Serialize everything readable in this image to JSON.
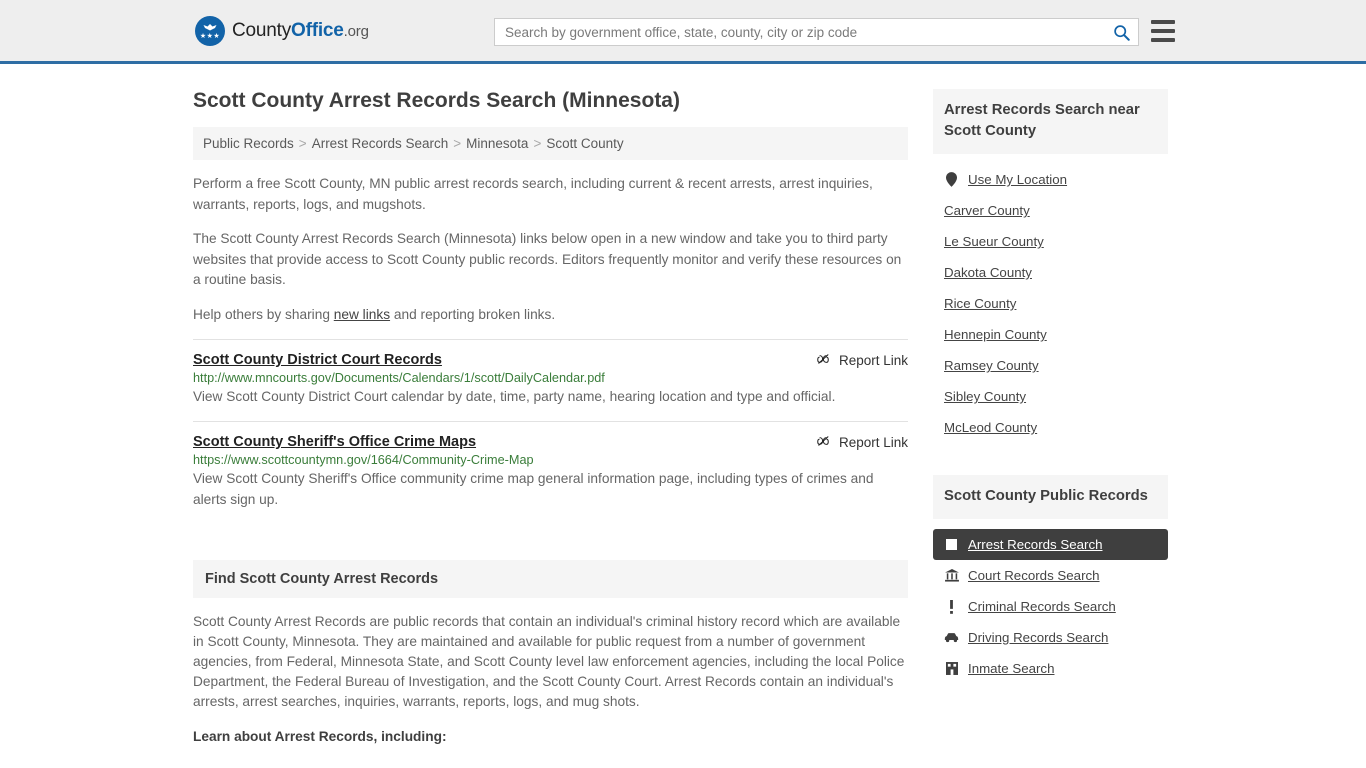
{
  "header": {
    "logo": {
      "part1": "County",
      "part2": "Office",
      "tld": ".org",
      "icon": "eagle-seal-icon"
    },
    "search": {
      "placeholder": "Search by government office, state, county, city or zip code",
      "value": "",
      "search_icon": "search-icon"
    },
    "menu_icon": "hamburger-menu-icon",
    "accent_color": "#2e6da4"
  },
  "page": {
    "title": "Scott County Arrest Records Search (Minnesota)"
  },
  "breadcrumb": {
    "separator": ">",
    "items": [
      {
        "label": "Public Records"
      },
      {
        "label": "Arrest Records Search"
      },
      {
        "label": "Minnesota"
      },
      {
        "label": "Scott County"
      }
    ]
  },
  "intro": {
    "p1": "Perform a free Scott County, MN public arrest records search, including current & recent arrests, arrest inquiries, warrants, reports, logs, and mugshots.",
    "p2": "The Scott County Arrest Records Search (Minnesota) links below open in a new window and take you to third party websites that provide access to Scott County public records. Editors frequently monitor and verify these resources on a routine basis.",
    "p3_before": "Help others by sharing ",
    "p3_link": "new links",
    "p3_after": " and reporting broken links."
  },
  "results": {
    "report_label": "Report Link",
    "report_icon": "broken-link-icon",
    "items": [
      {
        "title": "Scott County District Court Records",
        "url": "http://www.mncourts.gov/Documents/Calendars/1/scott/DailyCalendar.pdf",
        "description": "View Scott County District Court calendar by date, time, party name, hearing location and type and official."
      },
      {
        "title": "Scott County Sheriff's Office Crime Maps",
        "url": "https://www.scottcountymn.gov/1664/Community-Crime-Map",
        "description": "View Scott County Sheriff's Office community crime map general information page, including types of crimes and alerts sign up."
      }
    ]
  },
  "find_section": {
    "heading": "Find Scott County Arrest Records",
    "body": "Scott County Arrest Records are public records that contain an individual's criminal history record which are available in Scott County, Minnesota. They are maintained and available for public request from a number of government agencies, from Federal, Minnesota State, and Scott County level law enforcement agencies, including the local Police Department, the Federal Bureau of Investigation, and the Scott County Court. Arrest Records contain an individual's arrests, arrest searches, inquiries, warrants, reports, logs, and mug shots.",
    "learn_about": "Learn about Arrest Records, including:"
  },
  "sidebar": {
    "nearby": {
      "heading": "Arrest Records Search near Scott County",
      "items": [
        {
          "label": "Use My Location",
          "icon": "map-pin-icon"
        },
        {
          "label": "Carver County",
          "icon": ""
        },
        {
          "label": "Le Sueur County",
          "icon": ""
        },
        {
          "label": "Dakota County",
          "icon": ""
        },
        {
          "label": "Rice County",
          "icon": ""
        },
        {
          "label": "Hennepin County",
          "icon": ""
        },
        {
          "label": "Ramsey County",
          "icon": ""
        },
        {
          "label": "Sibley County",
          "icon": ""
        },
        {
          "label": "McLeod County",
          "icon": ""
        }
      ]
    },
    "public_records": {
      "heading": "Scott County Public Records",
      "active_color": "#3f3f3f",
      "items": [
        {
          "label": "Arrest Records Search",
          "icon": "white-square-icon",
          "active": true
        },
        {
          "label": "Court Records Search",
          "icon": "courthouse-icon",
          "active": false
        },
        {
          "label": "Criminal Records Search",
          "icon": "exclamation-icon",
          "active": false
        },
        {
          "label": "Driving Records Search",
          "icon": "car-icon",
          "active": false
        },
        {
          "label": "Inmate Search",
          "icon": "building-icon",
          "active": false
        }
      ]
    }
  }
}
